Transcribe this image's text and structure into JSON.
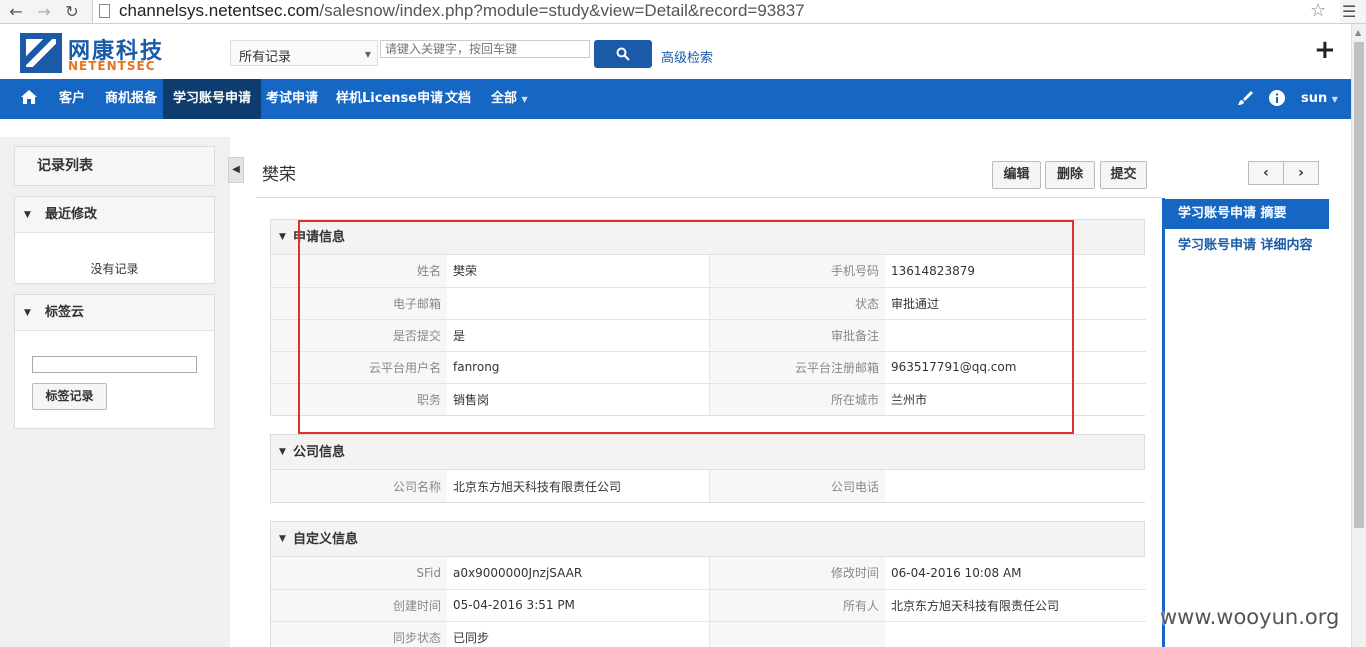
{
  "browser": {
    "url_host": "channelsys.netentsec.com",
    "url_path": "/salesnow/index.php?module=study&view=Detail&record=93837"
  },
  "header": {
    "logo_cn": "网康科技",
    "logo_en": "NETENTSEC",
    "record_filter": "所有记录",
    "search_placeholder": "请键入关键字，按回车键",
    "advanced_search": "高级检索"
  },
  "nav": {
    "items": [
      "客户",
      "商机报备",
      "学习账号申请",
      "考试申请",
      "样机License申请",
      "文档",
      "全部"
    ],
    "active_index": 2,
    "user": "sun"
  },
  "sidebar": {
    "record_list": "记录列表",
    "recent_title": "最近修改",
    "recent_empty": "没有记录",
    "tags_title": "标签云",
    "tag_button": "标签记录"
  },
  "record": {
    "title": "樊荣",
    "buttons": {
      "edit": "编辑",
      "delete": "删除",
      "submit": "提交"
    }
  },
  "blocks": {
    "apply": {
      "title": "申请信息",
      "rows": [
        {
          "l1": "姓名",
          "v1": "樊荣",
          "l2": "手机号码",
          "v2": "13614823879"
        },
        {
          "l1": "电子邮箱",
          "v1": "",
          "l2": "状态",
          "v2": "审批通过"
        },
        {
          "l1": "是否提交",
          "v1": "是",
          "l2": "审批备注",
          "v2": ""
        },
        {
          "l1": "云平台用户名",
          "v1": "fanrong",
          "l2": "云平台注册邮箱",
          "v2": "963517791@qq.com"
        },
        {
          "l1": "职务",
          "v1": "销售岗",
          "l2": "所在城市",
          "v2": "兰州市"
        }
      ]
    },
    "company": {
      "title": "公司信息",
      "rows": [
        {
          "l1": "公司名称",
          "v1": "北京东方旭天科技有限责任公司",
          "l2": "公司电话",
          "v2": ""
        }
      ]
    },
    "custom": {
      "title": "自定义信息",
      "rows": [
        {
          "l1": "SFid",
          "v1": "a0x9000000JnzjSAAR",
          "l2": "修改时间",
          "v2": "06-04-2016 10:08 AM"
        },
        {
          "l1": "创建时间",
          "v1": "05-04-2016 3:51 PM",
          "l2": "所有人",
          "v2": "北京东方旭天科技有限责任公司"
        },
        {
          "l1": "同步状态",
          "v1": "已同步",
          "l2": "",
          "v2": ""
        }
      ]
    }
  },
  "summary_panel": {
    "summary": "学习账号申请 摘要",
    "detail": "学习账号申请 详细内容"
  },
  "watermark": "www.wooyun.org"
}
